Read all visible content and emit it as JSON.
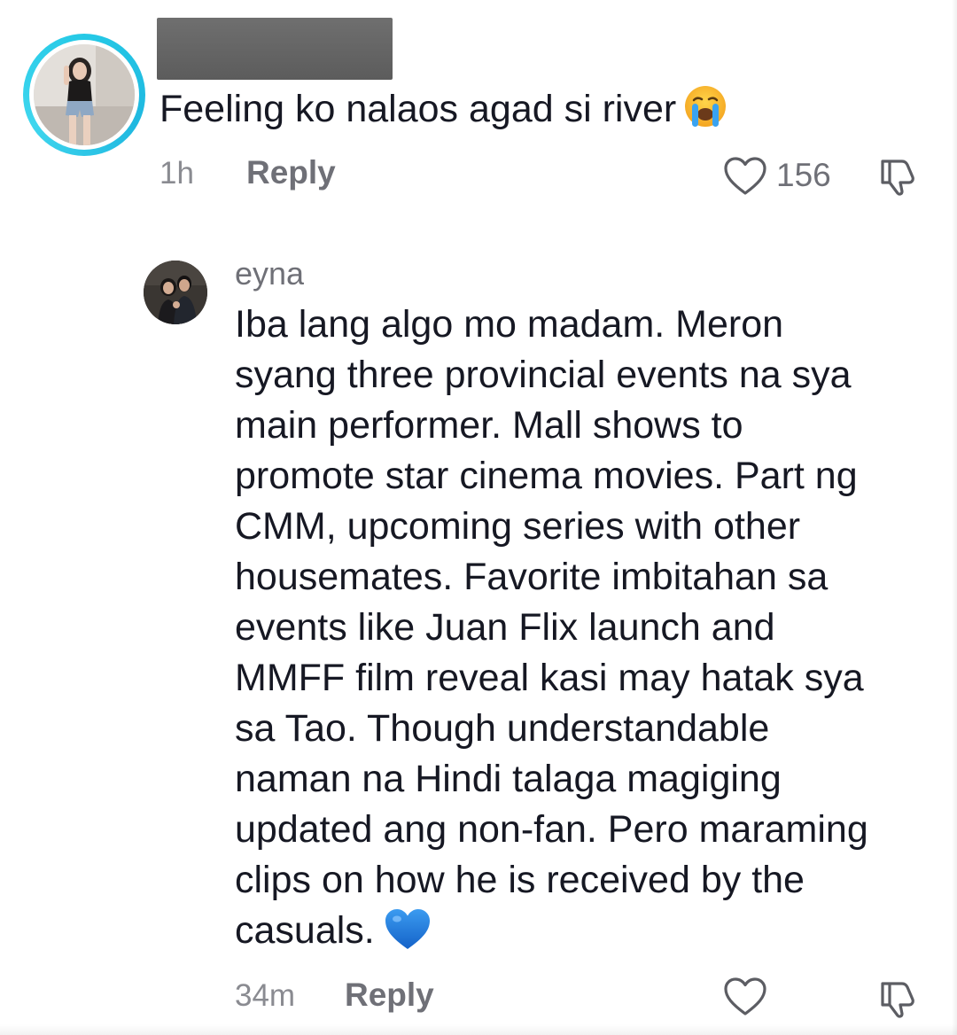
{
  "comment": {
    "username_redacted": true,
    "text": "Feeling ko nalaos agad si river",
    "emoji": "crying-face-emoji",
    "time": "1h",
    "reply_label": "Reply",
    "like_count": "156",
    "avatar_ring_color": "#25c9e6"
  },
  "reply": {
    "username": "eyna",
    "text_lines": [
      "Iba lang algo mo madam. Meron",
      "syang three provincial events na sya",
      "main performer. Mall shows to",
      "promote star cinema movies. Part ng",
      "CMM, upcoming series with other",
      "housemates. Favorite imbitahan sa",
      "events like Juan Flix launch and",
      "MMFF film reveal kasi may hatak sya",
      "sa Tao. Though understandable",
      "naman na Hindi talaga magiging",
      "updated ang non-fan. Pero maraming",
      "clips on how he is received by the",
      "casuals."
    ],
    "emoji": "blue-heart-emoji",
    "time": "34m",
    "reply_label": "Reply"
  },
  "colors": {
    "text_primary": "#161823",
    "text_secondary": "#6f7077",
    "text_muted": "#8a8b91",
    "icon_stroke": "#5c5d63",
    "heart_blue": "#1f7fe0"
  }
}
